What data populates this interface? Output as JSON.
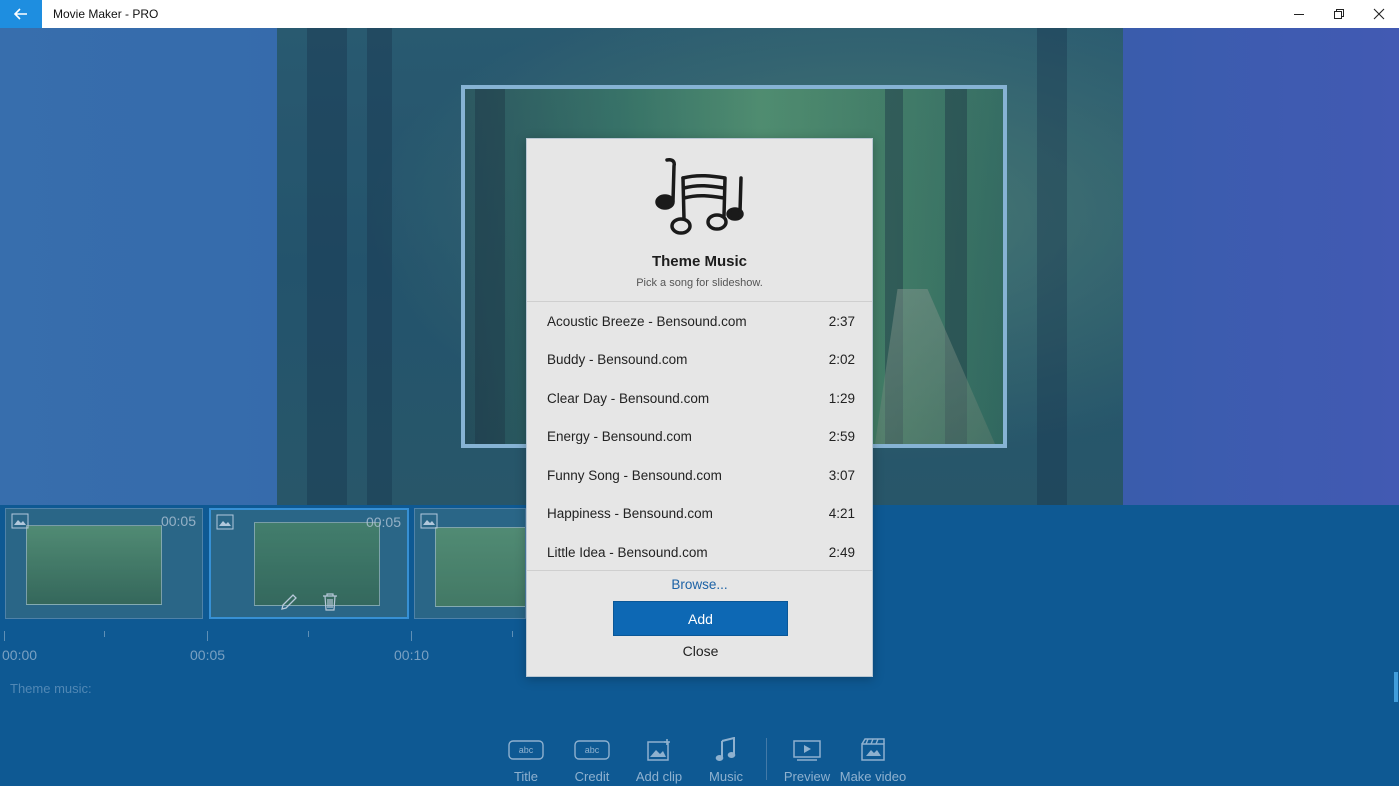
{
  "window": {
    "title": "Movie Maker - PRO"
  },
  "clips": [
    {
      "duration": "00:05"
    },
    {
      "duration": "00:05"
    },
    {
      "duration": ""
    }
  ],
  "timeline": {
    "ticks": [
      "00:00",
      "00:05",
      "00:10"
    ],
    "theme_music_label": "Theme music:"
  },
  "dialog": {
    "title": "Theme Music",
    "subtitle": "Pick a song for slideshow.",
    "songs": [
      {
        "name": "Acoustic Breeze - Bensound.com",
        "duration": "2:37"
      },
      {
        "name": "Buddy - Bensound.com",
        "duration": "2:02"
      },
      {
        "name": "Clear Day - Bensound.com",
        "duration": "1:29"
      },
      {
        "name": "Energy - Bensound.com",
        "duration": "2:59"
      },
      {
        "name": "Funny Song - Bensound.com",
        "duration": "3:07"
      },
      {
        "name": "Happiness - Bensound.com",
        "duration": "4:21"
      },
      {
        "name": "Little Idea - Bensound.com",
        "duration": "2:49"
      }
    ],
    "browse_label": "Browse...",
    "add_label": "Add",
    "close_label": "Close"
  },
  "toolbar": {
    "title_label": "Title",
    "credit_label": "Credit",
    "add_clip_label": "Add clip",
    "music_label": "Music",
    "preview_label": "Preview",
    "make_video_label": "Make video"
  },
  "colors": {
    "accent": "#0d68b4",
    "titlebar_back": "#1e8ee0",
    "timeline_bg": "#0d5d99"
  }
}
